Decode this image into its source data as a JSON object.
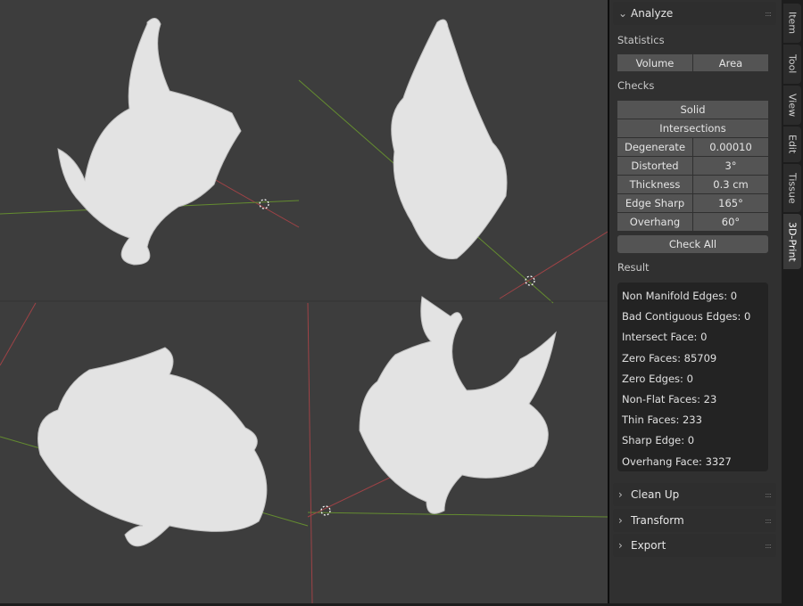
{
  "panel": {
    "analyze": {
      "title": "Analyze",
      "statistics_label": "Statistics",
      "volume_button": "Volume",
      "area_button": "Area",
      "checks_label": "Checks",
      "solid_button": "Solid",
      "intersections_button": "Intersections",
      "checks": [
        {
          "label": "Degenerate",
          "value": "0.00010"
        },
        {
          "label": "Distorted",
          "value": "3°"
        },
        {
          "label": "Thickness",
          "value": "0.3 cm"
        },
        {
          "label": "Edge Sharp",
          "value": "165°"
        },
        {
          "label": "Overhang",
          "value": "60°"
        }
      ],
      "check_all_button": "Check All",
      "result_label": "Result",
      "results": [
        "Non Manifold Edges: 0",
        "Bad Contiguous Edges: 0",
        "Intersect Face: 0",
        "Zero Faces: 85709",
        "Zero Edges: 0",
        "Non-Flat Faces: 23",
        "Thin Faces: 233",
        "Sharp Edge: 0",
        "Overhang Face: 3327"
      ]
    },
    "collapsed": [
      "Clean Up",
      "Transform",
      "Export"
    ]
  },
  "tabs": [
    "Item",
    "Tool",
    "View",
    "Edit",
    "Tissue",
    "3D-Print"
  ],
  "active_tab": "3D-Print",
  "colors": {
    "x_axis": "#c0474f",
    "y_axis": "#6b9a2e",
    "model": "#e6e6e6"
  }
}
